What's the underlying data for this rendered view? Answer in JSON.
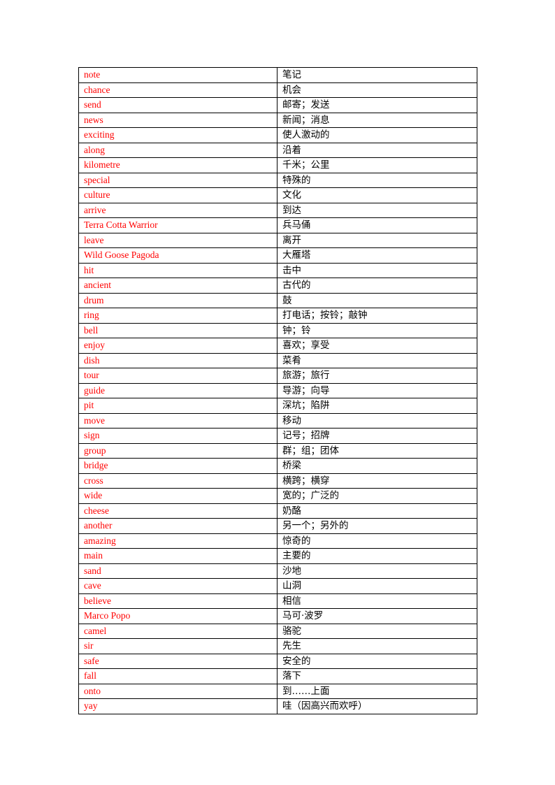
{
  "document": {
    "vocabulary": [
      {
        "english": "note",
        "chinese": "笔记"
      },
      {
        "english": "chance",
        "chinese": "机会"
      },
      {
        "english": "send",
        "chinese": "邮寄；发送"
      },
      {
        "english": "news",
        "chinese": "新闻；消息"
      },
      {
        "english": "exciting",
        "chinese": "使人激动的"
      },
      {
        "english": "along",
        "chinese": "沿着"
      },
      {
        "english": "kilometre",
        "chinese": "千米；公里"
      },
      {
        "english": "special",
        "chinese": "特殊的"
      },
      {
        "english": "culture",
        "chinese": "文化"
      },
      {
        "english": "arrive",
        "chinese": "到达"
      },
      {
        "english": "Terra Cotta Warrior",
        "chinese": "兵马俑"
      },
      {
        "english": "leave",
        "chinese": "离开"
      },
      {
        "english": "Wild Goose Pagoda",
        "chinese": "大雁塔"
      },
      {
        "english": "hit",
        "chinese": "击中"
      },
      {
        "english": "ancient",
        "chinese": "古代的"
      },
      {
        "english": "drum",
        "chinese": "鼓"
      },
      {
        "english": "ring",
        "chinese": "打电话；按铃；敲钟"
      },
      {
        "english": "bell",
        "chinese": "钟；铃"
      },
      {
        "english": "enjoy",
        "chinese": "喜欢；享受"
      },
      {
        "english": "dish",
        "chinese": "菜肴"
      },
      {
        "english": "tour",
        "chinese": "旅游；旅行"
      },
      {
        "english": "guide",
        "chinese": "导游；向导"
      },
      {
        "english": "pit",
        "chinese": "深坑；陷阱"
      },
      {
        "english": "move",
        "chinese": "移动"
      },
      {
        "english": "sign",
        "chinese": "记号；招牌"
      },
      {
        "english": "group",
        "chinese": "群；组；团体"
      },
      {
        "english": "bridge",
        "chinese": "桥梁"
      },
      {
        "english": "cross",
        "chinese": "横跨；横穿"
      },
      {
        "english": "wide",
        "chinese": "宽的；广泛的"
      },
      {
        "english": "cheese",
        "chinese": "奶酪"
      },
      {
        "english": "another",
        "chinese": "另一个；另外的"
      },
      {
        "english": "amazing",
        "chinese": "惊奇的"
      },
      {
        "english": "main",
        "chinese": "主要的"
      },
      {
        "english": "sand",
        "chinese": "沙地"
      },
      {
        "english": "cave",
        "chinese": "山洞"
      },
      {
        "english": "believe",
        "chinese": "相信"
      },
      {
        "english": "Marco Popo",
        "chinese": "马可·波罗"
      },
      {
        "english": "camel",
        "chinese": "骆驼"
      },
      {
        "english": "sir",
        "chinese": "先生"
      },
      {
        "english": "safe",
        "chinese": "安全的"
      },
      {
        "english": "fall",
        "chinese": "落下"
      },
      {
        "english": "onto",
        "chinese": "到……上面"
      },
      {
        "english": "yay",
        "chinese": "哇（因高兴而欢呼）"
      }
    ]
  },
  "colors": {
    "english_text": "#ff0000",
    "chinese_text": "#000000",
    "border": "#000000"
  }
}
